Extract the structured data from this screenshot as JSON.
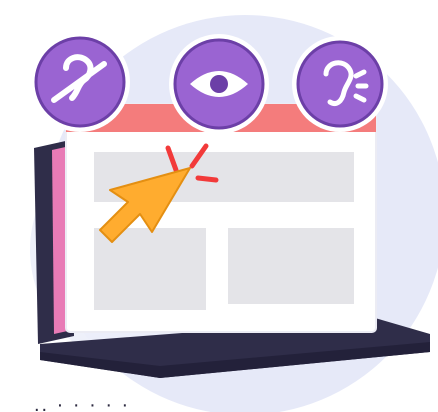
{
  "illustration": {
    "icons": [
      {
        "name": "hearing-disabled-icon"
      },
      {
        "name": "eye-icon"
      },
      {
        "name": "ear-icon"
      }
    ],
    "colors": {
      "background_blob": "#e6e9f8",
      "icon_circle": "#9a64d2",
      "icon_circle_dark": "#6c3fa7",
      "browser_bar": "#f47c7c",
      "laptop_dark": "#2f2d49",
      "laptop_side_pink": "#e87bb6",
      "placeholder_gray": "#e4e4e8",
      "cursor_orange": "#ffac2f",
      "click_red": "#f23a3a"
    }
  },
  "footer": {
    "text": "..  ·  ·  ·  ·  ·"
  }
}
